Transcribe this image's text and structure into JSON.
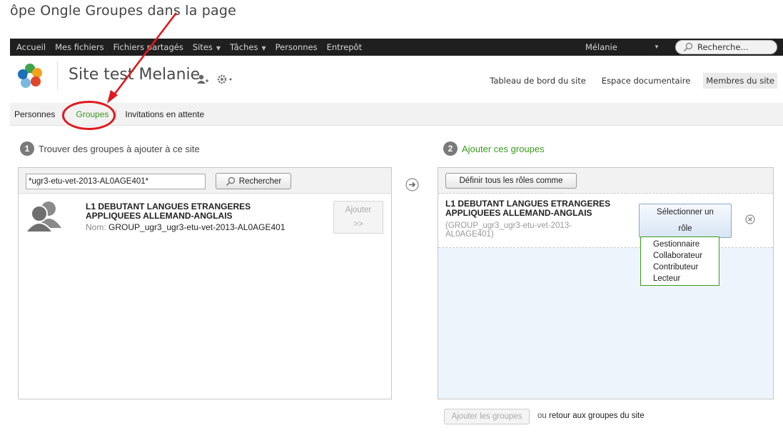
{
  "caption": "ôpe      Ongle   Groupes  dans la page",
  "topnav": {
    "items": [
      {
        "label": "Accueil",
        "caret": false
      },
      {
        "label": "Mes fichiers",
        "caret": false
      },
      {
        "label": "Fichiers partagés",
        "caret": false
      },
      {
        "label": "Sites",
        "caret": true
      },
      {
        "label": "Tâches",
        "caret": true
      },
      {
        "label": "Personnes",
        "caret": false
      },
      {
        "label": "Entrepôt",
        "caret": false
      }
    ],
    "user": "Mélanie",
    "search_placeholder": "Recherche..."
  },
  "site": {
    "title": "Site test Melanie",
    "links": [
      "Tableau de bord du site",
      "Espace documentaire",
      "Membres du site"
    ],
    "active_link": "Membres du site"
  },
  "subnav": {
    "items": [
      "Personnes",
      "Groupes",
      "Invitations en attente"
    ],
    "active": "Groupes"
  },
  "step1": {
    "num": "1",
    "label": "Trouver des groupes à ajouter à ce site"
  },
  "step2": {
    "num": "2",
    "label": "Ajouter ces groupes"
  },
  "search": {
    "value": "*ugr3-etu-vet-2013-AL0AGE401*",
    "button": "Rechercher"
  },
  "result": {
    "title": "L1 DEBUTANT LANGUES ETRANGERES APPLIQUEES ALLEMAND-ANGLAIS",
    "name_key": "Nom:",
    "name_value": "GROUP_ugr3_ugr3-etu-vet-2013-AL0AGE401",
    "add_label": "Ajouter",
    "add_sub": ">>"
  },
  "selection": {
    "roles_button": "Définir tous les rôles comme",
    "title": "L1 DEBUTANT LANGUES ETRANGERES APPLIQUEES ALLEMAND-ANGLAIS",
    "subtitle": "(GROUP_ugr3_ugr3-etu-vet-2013-AL0AGE401)",
    "role_button_line1": "Sélectionner un",
    "role_button_line2": "rôle",
    "role_options": [
      "Gestionnaire",
      "Collaborateur",
      "Contributeur",
      "Lecteur"
    ]
  },
  "footer": {
    "add_groups": "Ajouter les groupes",
    "ou": "ou",
    "return": "retour aux groupes du site"
  },
  "colors": {
    "accent_green": "#3a9a1e",
    "annotation_red": "#e0191f",
    "topbar": "#1f1f1f"
  }
}
